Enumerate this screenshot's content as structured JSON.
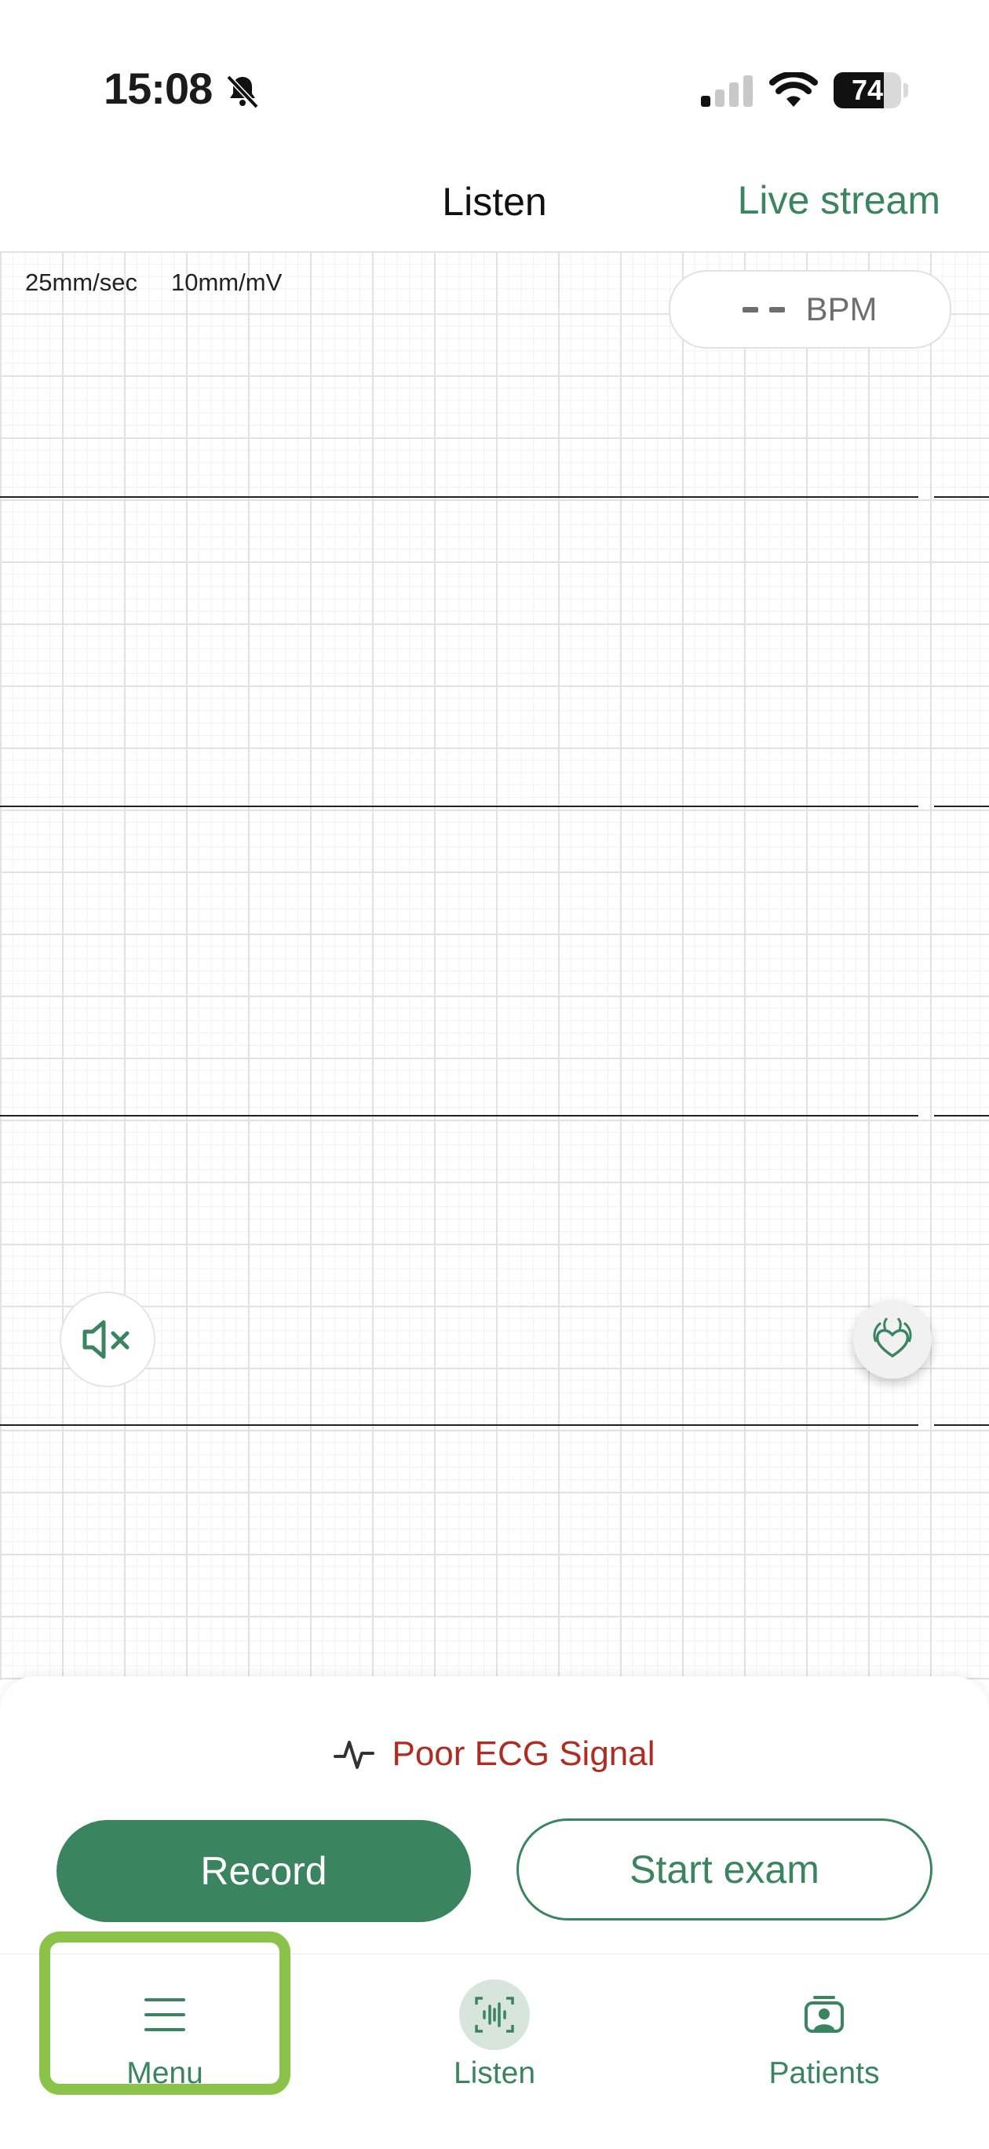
{
  "status_bar": {
    "time": "15:08",
    "battery": "74",
    "battery_level": 0.74,
    "icons": [
      "bell-slash-icon",
      "cellular-signal-icon",
      "wifi-icon",
      "battery-icon"
    ]
  },
  "header": {
    "title": "Listen",
    "live_stream_label": "Live stream"
  },
  "ecg": {
    "speed_label": "25mm/sec",
    "gain_label": "10mm/mV",
    "bpm_value": "- -",
    "bpm_unit": "BPM",
    "trace_count": 4
  },
  "controls": {
    "mute_icon": "speaker-mute-icon",
    "organ_icon": "heart-lungs-icon"
  },
  "bottom_panel": {
    "signal_status": "Poor ECG Signal",
    "signal_icon": "ecg-pulse-icon",
    "record_label": "Record",
    "start_exam_label": "Start exam"
  },
  "tab_bar": {
    "tabs": [
      {
        "label": "Menu",
        "icon": "menu-icon",
        "highlighted": true
      },
      {
        "label": "Listen",
        "icon": "waveform-icon",
        "active": true
      },
      {
        "label": "Patients",
        "icon": "patient-badge-icon"
      }
    ]
  },
  "colors": {
    "accent": "#3a8460",
    "warning": "#b02b22",
    "highlight": "#8bc34a"
  }
}
